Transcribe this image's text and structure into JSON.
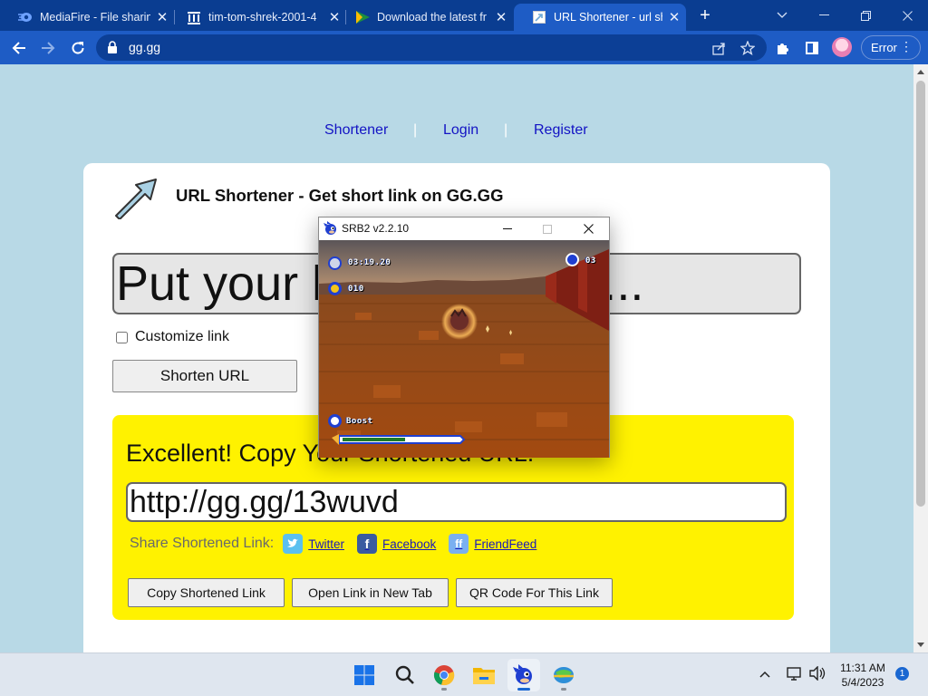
{
  "browser": {
    "tabs": [
      {
        "title": "MediaFire - File sharing",
        "icon": "mediafire-icon"
      },
      {
        "title": "tim-tom-shrek-2001-4",
        "icon": "archive-icon"
      },
      {
        "title": "Download the latest fr",
        "icon": "play-triangle-icon"
      },
      {
        "title": "URL Shortener - url sh",
        "icon": "page-icon",
        "active": true
      }
    ],
    "address": "gg.gg",
    "profile_status": "Error"
  },
  "site": {
    "nav": {
      "shortener": "Shortener",
      "login": "Login",
      "register": "Register",
      "separator": "|"
    },
    "title": "URL Shortener - Get short link on GG.GG",
    "long_url_placeholder": "Put your long link here...",
    "customize_label": "Customize link",
    "shorten_button": "Shorten URL",
    "result": {
      "message": "Excellent! Copy Your Shortened URL:",
      "short_url": "http://gg.gg/13wuvd",
      "share_label": "Share Shortened Link:",
      "share_links": [
        "Twitter",
        "Facebook",
        "FriendFeed"
      ],
      "buttons": {
        "copy": "Copy Shortened Link",
        "open": "Open Link in New Tab",
        "qr": "QR Code For This Link"
      }
    }
  },
  "game_window": {
    "title": "SRB2 v2.2.10",
    "hud": {
      "time": "03:19.20",
      "rings": "010",
      "lives": "03",
      "ability": "Boost"
    },
    "boost_fill": 0.55
  },
  "taskbar": {
    "apps": [
      "start-icon",
      "search-icon",
      "chrome-icon",
      "file-explorer-icon",
      "srb2-icon",
      "network-app-icon"
    ],
    "time": "11:31 AM",
    "date": "5/4/2023",
    "notifications": "1"
  },
  "colors": {
    "chrome_frame": "#0a3d91",
    "chrome_toolbar": "#1e5cc5",
    "page_background": "#b8d9e6",
    "result_box": "#fff200",
    "nav_link": "#1313c4"
  }
}
